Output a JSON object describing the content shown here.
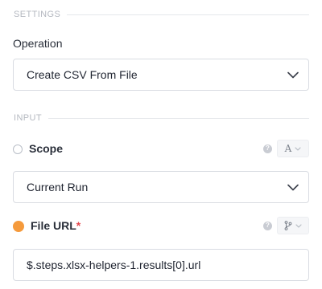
{
  "settings": {
    "header": "SETTINGS",
    "operation": {
      "label": "Operation",
      "value": "Create CSV From File"
    }
  },
  "input": {
    "header": "INPUT",
    "scope": {
      "label": "Scope",
      "type_icon_glyph": "A",
      "value": "Current Run"
    },
    "file_url": {
      "label": "File URL",
      "required_mark": "*",
      "indicator_color": "#f59a3c",
      "value": "$.steps.xlsx-helpers-1.results[0].url"
    }
  },
  "icons": {
    "help": "?",
    "chevron": "chevron-down-icon",
    "branch": "branch-icon",
    "text_type": "text-type-icon"
  }
}
